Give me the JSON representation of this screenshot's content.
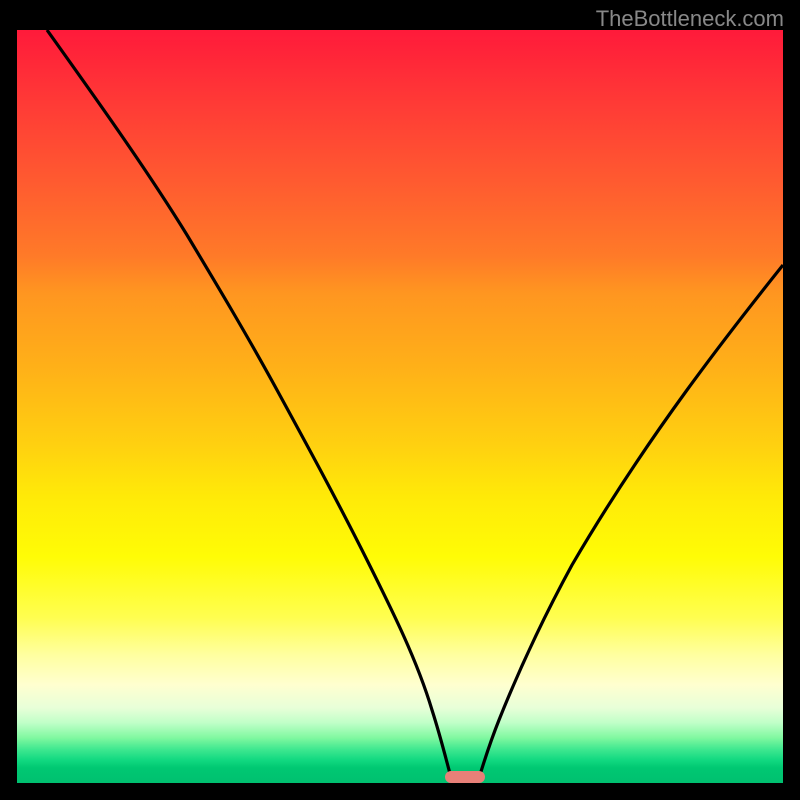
{
  "watermark": "TheBottleneck.com",
  "chart_data": {
    "type": "line",
    "title": "",
    "xlabel": "",
    "ylabel": "",
    "xlim": [
      0,
      100
    ],
    "ylim": [
      0,
      100
    ],
    "series": [
      {
        "name": "left-curve",
        "x": [
          4,
          8,
          12,
          16,
          20,
          24,
          28,
          32,
          35,
          38,
          41,
          44,
          47,
          50,
          51.5,
          53,
          54,
          55,
          56
        ],
        "y": [
          100,
          92,
          85,
          78,
          70,
          62,
          55,
          48,
          42,
          36,
          30,
          24,
          18,
          12,
          8,
          5,
          3,
          1.5,
          0.5
        ]
      },
      {
        "name": "right-curve",
        "x": [
          60,
          62,
          65,
          68,
          72,
          76,
          80,
          84,
          88,
          92,
          96,
          100
        ],
        "y": [
          0.5,
          2,
          5,
          9,
          15,
          22,
          30,
          38,
          46,
          54,
          61,
          68
        ]
      }
    ],
    "highlight": {
      "x_start": 55.5,
      "x_end": 60.5,
      "color": "#e88078"
    },
    "gradient_stops": [
      {
        "pos": 0,
        "color": "#ff1a3a"
      },
      {
        "pos": 50,
        "color": "#ffb020"
      },
      {
        "pos": 75,
        "color": "#ffff60"
      },
      {
        "pos": 100,
        "color": "#00c070"
      }
    ]
  }
}
